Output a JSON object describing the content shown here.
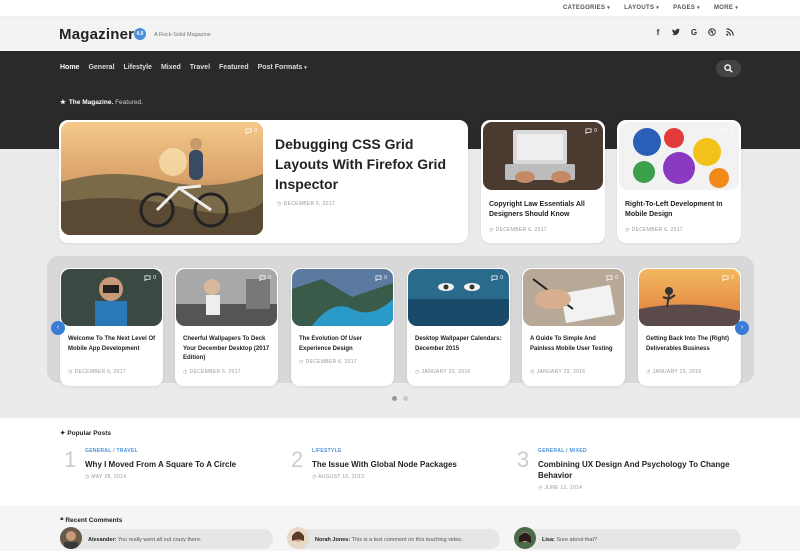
{
  "topbar": {
    "menu": [
      {
        "label": "CATEGORIES"
      },
      {
        "label": "LAYOUTS"
      },
      {
        "label": "PAGES"
      },
      {
        "label": "MORE"
      }
    ]
  },
  "header": {
    "logo": "Magaziner",
    "badge": "4.0",
    "tagline": "A Rock-Solid Magazine",
    "social": [
      "facebook-icon",
      "twitter-icon",
      "google-icon",
      "dribbble-icon",
      "rss-icon"
    ]
  },
  "nav": {
    "items": [
      {
        "label": "Home"
      },
      {
        "label": "General"
      },
      {
        "label": "Lifestyle"
      },
      {
        "label": "Mixed"
      },
      {
        "label": "Travel"
      },
      {
        "label": "Featured"
      },
      {
        "label": "Post Formats"
      }
    ]
  },
  "featured": {
    "heading": "The Magazine.",
    "subheading": "Featured.",
    "main": {
      "title": "Debugging CSS Grid Layouts With Firefox Grid Inspector",
      "date": "DECEMBER 6, 2017",
      "comments": "0"
    },
    "side": [
      {
        "title": "Copyright Law Essentials All Designers Should Know",
        "date": "DECEMBER 6, 2017",
        "comments": "0"
      },
      {
        "title": "Right-To-Left Development In Mobile Design",
        "date": "DECEMBER 6, 2017",
        "comments": "0"
      }
    ]
  },
  "carousel": {
    "items": [
      {
        "title": "Welcome To The Next Level Of Mobile App Development",
        "date": "DECEMBER 6, 2017",
        "comments": "0"
      },
      {
        "title": "Cheerful Wallpapers To Deck Your December Desktop (2017 Edition)",
        "date": "DECEMBER 6, 2017",
        "comments": "0"
      },
      {
        "title": "The Evolution Of User Experience Design",
        "date": "DECEMBER 6, 2017",
        "comments": "0"
      },
      {
        "title": "Desktop Wallpaper Calendars: December 2015",
        "date": "JANUARY 29, 2016",
        "comments": "0"
      },
      {
        "title": "A Guide To Simple And Painless Mobile User Testing",
        "date": "JANUARY 29, 2016",
        "comments": "0"
      },
      {
        "title": "Getting Back Into The (Right) Deliverables Business",
        "date": "JANUARY 29, 2016",
        "comments": "0"
      }
    ]
  },
  "popular": {
    "heading": "Popular Posts",
    "items": [
      {
        "num": "1",
        "cat1": "GENERAL",
        "cat2": "TRAVEL",
        "title": "Why I Moved From A Square To A Circle",
        "date": "MAY 28, 2014"
      },
      {
        "num": "2",
        "cat1": "LIFESTYLE",
        "cat2": "",
        "title": "The Issue With Global Node Packages",
        "date": "AUGUST 15, 2013"
      },
      {
        "num": "3",
        "cat1": "GENERAL",
        "cat2": "MIXED",
        "title": "Combining UX Design And Psychology To Change Behavior",
        "date": "JUNE 13, 2014"
      }
    ]
  },
  "recent": {
    "heading": "Recent Comments",
    "items": [
      {
        "author": "Alexander:",
        "text": "You really went all out crazy there."
      },
      {
        "author": "Norah Jones:",
        "text": "This is a test comment on this touching video."
      },
      {
        "author": "Lisa:",
        "text": "Sure about that?"
      }
    ]
  },
  "colors": {
    "accent": "#4a90d9",
    "arrow": "#3a7bd5",
    "dark": "#2a2a2a"
  }
}
